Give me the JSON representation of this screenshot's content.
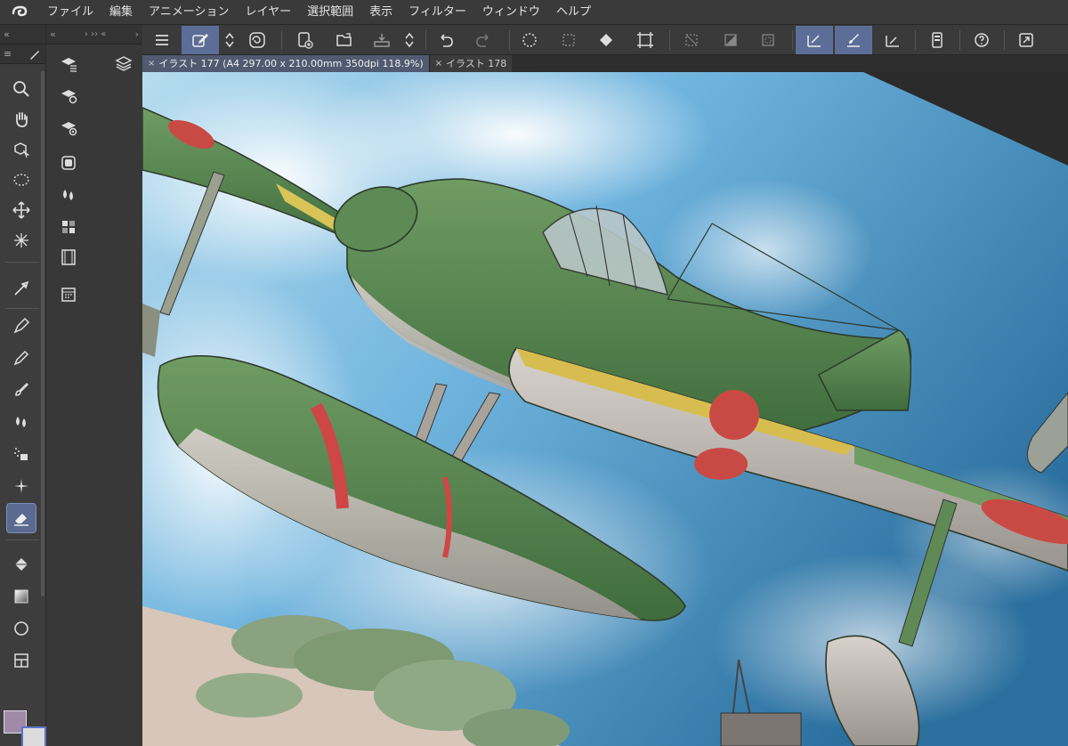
{
  "menubar": {
    "items": [
      "ファイル",
      "編集",
      "アニメーション",
      "レイヤー",
      "選択範囲",
      "表示",
      "フィルター",
      "ウィンドウ",
      "ヘルプ"
    ]
  },
  "tool_panel": {
    "collapse_glyph": "«",
    "expand_glyph": "›",
    "tools": [
      "zoom-icon",
      "hand-icon",
      "object-select-icon",
      "lasso-select-icon",
      "move-icon",
      "auto-select-icon",
      "eyedropper-icon",
      "pen-icon",
      "pencil-icon",
      "brush-icon",
      "watercolor-icon",
      "airbrush-icon",
      "decoration-icon",
      "eraser-icon",
      "fill-icon",
      "gradient-icon",
      "figure-icon",
      "frame-icon"
    ],
    "active_tool": "eraser-icon"
  },
  "colors": {
    "main": "#a08aa8",
    "sub": "#dcdcdc",
    "accent": "#5c6e98",
    "sky": "#3a86c0",
    "plane_green": "#5a8a52"
  },
  "document_tabs": [
    {
      "label": "イラスト 177 (A4 297.00 x 210.00mm 350dpi 118.9%)",
      "active": true
    },
    {
      "label": "イラスト 178",
      "active": false
    }
  ],
  "tab_close_glyph": "×"
}
